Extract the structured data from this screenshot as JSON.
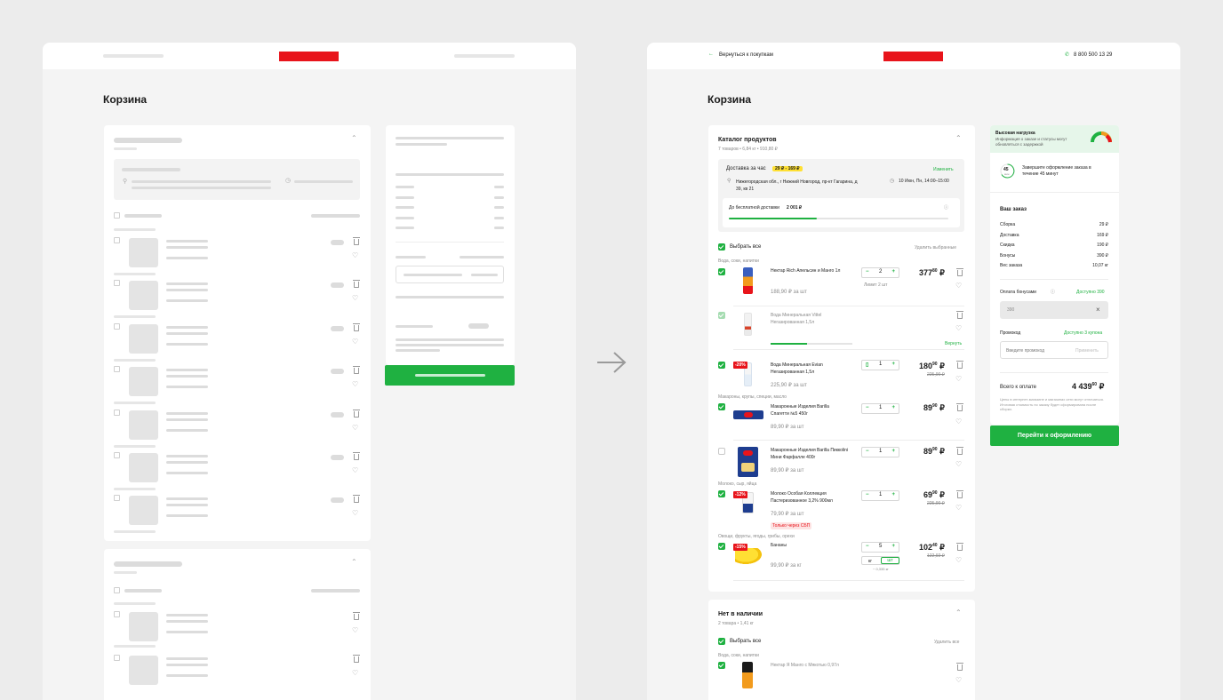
{
  "left_mockup": {
    "page_title": "Корзина"
  },
  "right_mockup": {
    "header": {
      "back_label": "Вернуться к покупкам",
      "phone": "8 800 500 13 29"
    },
    "page_title": "Корзина",
    "catalog": {
      "title": "Каталог продуктов",
      "meta": "7 товаров  •  6,84 кг  •  910,80 ₽",
      "delivery_label": "Доставка за час",
      "delivery_price": "29 ₽ - 169 ₽",
      "change_label": "Изменить",
      "address": "Нижегородская обл., г Нижний Новгород, пр-кт Гагарина, д 39, кв 21",
      "time": "10 Июн, Пн, 14:00–15:00",
      "free_delivery_label": "До бесплатной доставки",
      "free_delivery_amount": "2 001 ₽",
      "free_delivery_progress": 0.4,
      "select_all_label": "Выбрать все",
      "delete_selected_label": "Удалить выбранные"
    },
    "categories": {
      "water": "Вода, соки, напитки",
      "pasta": "Макароны, крупы, специи, масло",
      "milk": "Молоко, сыр, яйца",
      "fruits": "Овощи, фрукты, ягоды, грибы, орехи"
    },
    "items": [
      {
        "name": "Нектар Rich Апельсин и Манго 1л",
        "unit_price": "188,90 ₽ за шт",
        "qty": "2",
        "limit": "Лимит 2 шт",
        "price_int": "377",
        "price_dec": "80",
        "currency": "₽"
      },
      {
        "name": "Вода Минеральная Vittel Негазированная 1,5л",
        "return_label": "Вернуть",
        "restore_progress": 0.45
      },
      {
        "name": "Вода Минеральная Evian Негазированная 1,5л",
        "unit_price": "225,90 ₽ за шт",
        "qty": "1",
        "price_int": "180",
        "price_dec": "90",
        "currency": "₽",
        "old_price": "225,90 ₽",
        "badge": "-20%"
      },
      {
        "name": "Макаронные Изделия Barilla Спагетти №5 450г",
        "unit_price": "89,90 ₽ за шт",
        "qty": "1",
        "price_int": "89",
        "price_dec": "90",
        "currency": "₽"
      },
      {
        "name": "Макаронные Изделия Barilla Пиккolini Мини Фарфалле 400г",
        "unit_price": "89,90 ₽ за шт",
        "qty": "1",
        "price_int": "89",
        "price_dec": "90",
        "currency": "₽"
      },
      {
        "name": "Молоко Особая Коллекция Пастеризованное 3,2% 900мл",
        "unit_price": "79,90 ₽ за шт",
        "qty": "1",
        "price_int": "69",
        "price_dec": "90",
        "currency": "₽",
        "old_price": "225,90 ₽",
        "badge": "-12%",
        "tag": "Только через СБП"
      },
      {
        "name": "Бананы",
        "unit_price": "99,90 ₽ за кг",
        "qty": "5",
        "price_int": "102",
        "price_dec": "40",
        "currency": "₽",
        "old_price": "122,92 ₽",
        "badge": "-15%",
        "unit_kg": "кг",
        "unit_pcs": "шт",
        "weight_note": "~ 0,335 кг"
      }
    ],
    "out_of_stock": {
      "title": "Нет в наличии",
      "meta": "2 товара  •  1,41 кг",
      "select_all_label": "Выбрать все",
      "delete_label": "Удалить все",
      "category": "Вода, соки, напитки",
      "first_item": "Нектар Я Манго с Мякотью 0,97л"
    },
    "summary": {
      "load_title": "Высокая нагрузка",
      "load_text": "Информация о заказе и статусы могут обновляться с задержкой",
      "timer_value": "45",
      "timer_unit": "мин",
      "timer_text": "Завершите оформление заказа в течение 45 минут",
      "order_title": "Ваш заказ",
      "rows": [
        {
          "label": "Сборка",
          "value": "29 ₽"
        },
        {
          "label": "Доставка",
          "value": "169 ₽"
        },
        {
          "label": "Скидка",
          "value": "190 ₽"
        },
        {
          "label": "Бонусы",
          "value": "390 ₽"
        },
        {
          "label": "Вес заказа",
          "value": "10,07 кг"
        }
      ],
      "bonus_label": "Оплата бонусами",
      "bonus_available": "Доступно 390",
      "bonus_value": "390",
      "promo_label": "Промокод",
      "promo_available": "Доступно 3 купона",
      "promo_placeholder": "Введите промокод",
      "promo_apply": "Применить",
      "total_label": "Всего к оплате",
      "total_int": "4 439",
      "total_dec": "60",
      "total_currency": "₽",
      "note": "Цены в интернет-магазине и магазинах сети могут отличаться. Итоговая стоимость по заказу будет сформирована после сборки.",
      "checkout_label": "Перейти к оформлению"
    }
  },
  "colors": {
    "accent": "#1fb141",
    "brand_red": "#e8141b",
    "highlight_yellow": "#ffe033"
  }
}
